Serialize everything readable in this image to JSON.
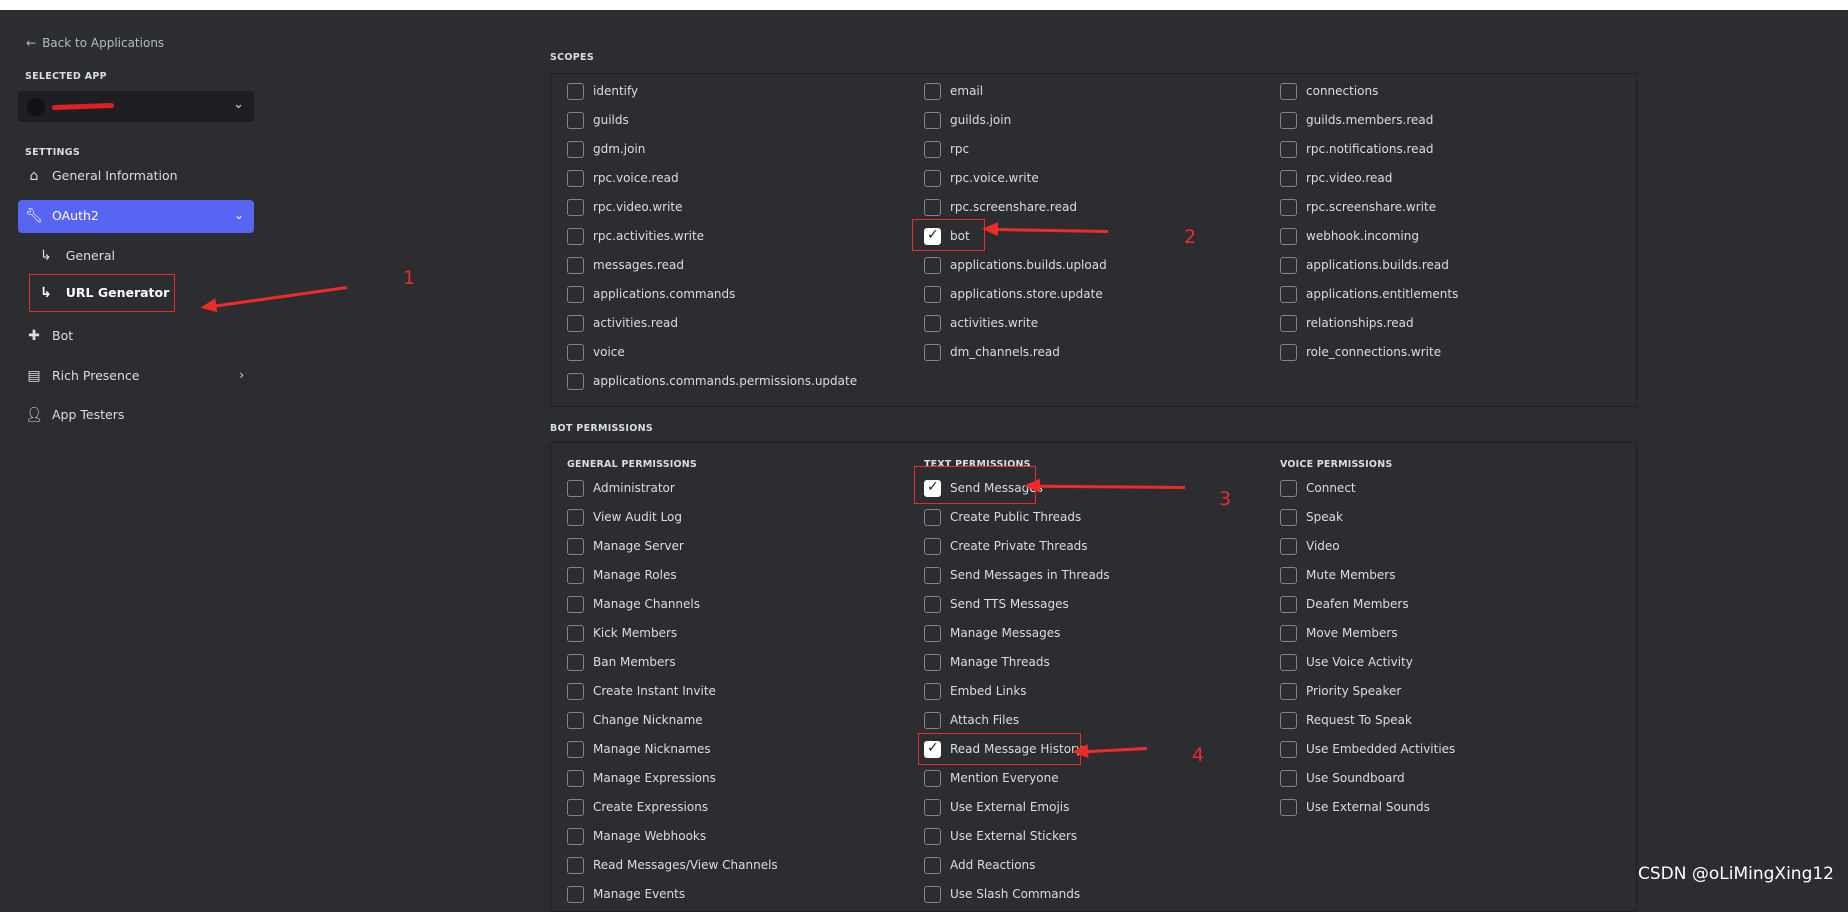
{
  "sidebar": {
    "back_label": "Back to Applications",
    "selected_app_label": "SELECTED APP",
    "app_name": "",
    "settings_label": "SETTINGS",
    "nav": [
      {
        "label": "General Information",
        "icon": "home-icon"
      },
      {
        "label": "OAuth2",
        "icon": "wrench-icon",
        "expanded": true
      },
      {
        "label": "General",
        "icon": "sub-arrow-icon"
      },
      {
        "label": "URL Generator",
        "icon": "sub-arrow-icon",
        "current": true
      },
      {
        "label": "Bot",
        "icon": "puzzle-icon"
      },
      {
        "label": "Rich Presence",
        "icon": "document-icon"
      },
      {
        "label": "App Testers",
        "icon": "user-icon"
      }
    ]
  },
  "scopes": {
    "heading": "SCOPES",
    "items": [
      {
        "label": "identify",
        "checked": false
      },
      {
        "label": "email",
        "checked": false
      },
      {
        "label": "connections",
        "checked": false
      },
      {
        "label": "guilds",
        "checked": false
      },
      {
        "label": "guilds.join",
        "checked": false
      },
      {
        "label": "guilds.members.read",
        "checked": false
      },
      {
        "label": "gdm.join",
        "checked": false
      },
      {
        "label": "rpc",
        "checked": false
      },
      {
        "label": "rpc.notifications.read",
        "checked": false
      },
      {
        "label": "rpc.voice.read",
        "checked": false
      },
      {
        "label": "rpc.voice.write",
        "checked": false
      },
      {
        "label": "rpc.video.read",
        "checked": false
      },
      {
        "label": "rpc.video.write",
        "checked": false
      },
      {
        "label": "rpc.screenshare.read",
        "checked": false
      },
      {
        "label": "rpc.screenshare.write",
        "checked": false
      },
      {
        "label": "rpc.activities.write",
        "checked": false
      },
      {
        "label": "bot",
        "checked": true
      },
      {
        "label": "webhook.incoming",
        "checked": false
      },
      {
        "label": "messages.read",
        "checked": false
      },
      {
        "label": "applications.builds.upload",
        "checked": false
      },
      {
        "label": "applications.builds.read",
        "checked": false
      },
      {
        "label": "applications.commands",
        "checked": false
      },
      {
        "label": "applications.store.update",
        "checked": false
      },
      {
        "label": "applications.entitlements",
        "checked": false
      },
      {
        "label": "activities.read",
        "checked": false
      },
      {
        "label": "activities.write",
        "checked": false
      },
      {
        "label": "relationships.read",
        "checked": false
      },
      {
        "label": "voice",
        "checked": false
      },
      {
        "label": "dm_channels.read",
        "checked": false
      },
      {
        "label": "role_connections.write",
        "checked": false
      },
      {
        "label": "applications.commands.permissions.update",
        "checked": false
      }
    ]
  },
  "bot_permissions": {
    "heading": "BOT PERMISSIONS",
    "columns": [
      {
        "title": "GENERAL PERMISSIONS",
        "items": [
          {
            "label": "Administrator",
            "checked": false
          },
          {
            "label": "View Audit Log",
            "checked": false
          },
          {
            "label": "Manage Server",
            "checked": false
          },
          {
            "label": "Manage Roles",
            "checked": false
          },
          {
            "label": "Manage Channels",
            "checked": false
          },
          {
            "label": "Kick Members",
            "checked": false
          },
          {
            "label": "Ban Members",
            "checked": false
          },
          {
            "label": "Create Instant Invite",
            "checked": false
          },
          {
            "label": "Change Nickname",
            "checked": false
          },
          {
            "label": "Manage Nicknames",
            "checked": false
          },
          {
            "label": "Manage Expressions",
            "checked": false
          },
          {
            "label": "Create Expressions",
            "checked": false
          },
          {
            "label": "Manage Webhooks",
            "checked": false
          },
          {
            "label": "Read Messages/View Channels",
            "checked": false
          },
          {
            "label": "Manage Events",
            "checked": false
          }
        ]
      },
      {
        "title": "TEXT PERMISSIONS",
        "items": [
          {
            "label": "Send Messages",
            "checked": true
          },
          {
            "label": "Create Public Threads",
            "checked": false
          },
          {
            "label": "Create Private Threads",
            "checked": false
          },
          {
            "label": "Send Messages in Threads",
            "checked": false
          },
          {
            "label": "Send TTS Messages",
            "checked": false
          },
          {
            "label": "Manage Messages",
            "checked": false
          },
          {
            "label": "Manage Threads",
            "checked": false
          },
          {
            "label": "Embed Links",
            "checked": false
          },
          {
            "label": "Attach Files",
            "checked": false
          },
          {
            "label": "Read Message History",
            "checked": true
          },
          {
            "label": "Mention Everyone",
            "checked": false
          },
          {
            "label": "Use External Emojis",
            "checked": false
          },
          {
            "label": "Use External Stickers",
            "checked": false
          },
          {
            "label": "Add Reactions",
            "checked": false
          },
          {
            "label": "Use Slash Commands",
            "checked": false
          }
        ]
      },
      {
        "title": "VOICE PERMISSIONS",
        "items": [
          {
            "label": "Connect",
            "checked": false
          },
          {
            "label": "Speak",
            "checked": false
          },
          {
            "label": "Video",
            "checked": false
          },
          {
            "label": "Mute Members",
            "checked": false
          },
          {
            "label": "Deafen Members",
            "checked": false
          },
          {
            "label": "Move Members",
            "checked": false
          },
          {
            "label": "Use Voice Activity",
            "checked": false
          },
          {
            "label": "Priority Speaker",
            "checked": false
          },
          {
            "label": "Request To Speak",
            "checked": false
          },
          {
            "label": "Use Embedded Activities",
            "checked": false
          },
          {
            "label": "Use Soundboard",
            "checked": false
          },
          {
            "label": "Use External Sounds",
            "checked": false
          }
        ]
      }
    ]
  },
  "annotations": [
    "1",
    "2",
    "3",
    "4"
  ],
  "watermark": "CSDN @oLiMingXing12",
  "colors": {
    "accent": "#5865f2",
    "annotation": "#ed2b2b",
    "sidebar_bg": "#2b2d31",
    "main_bg": "#313338"
  }
}
